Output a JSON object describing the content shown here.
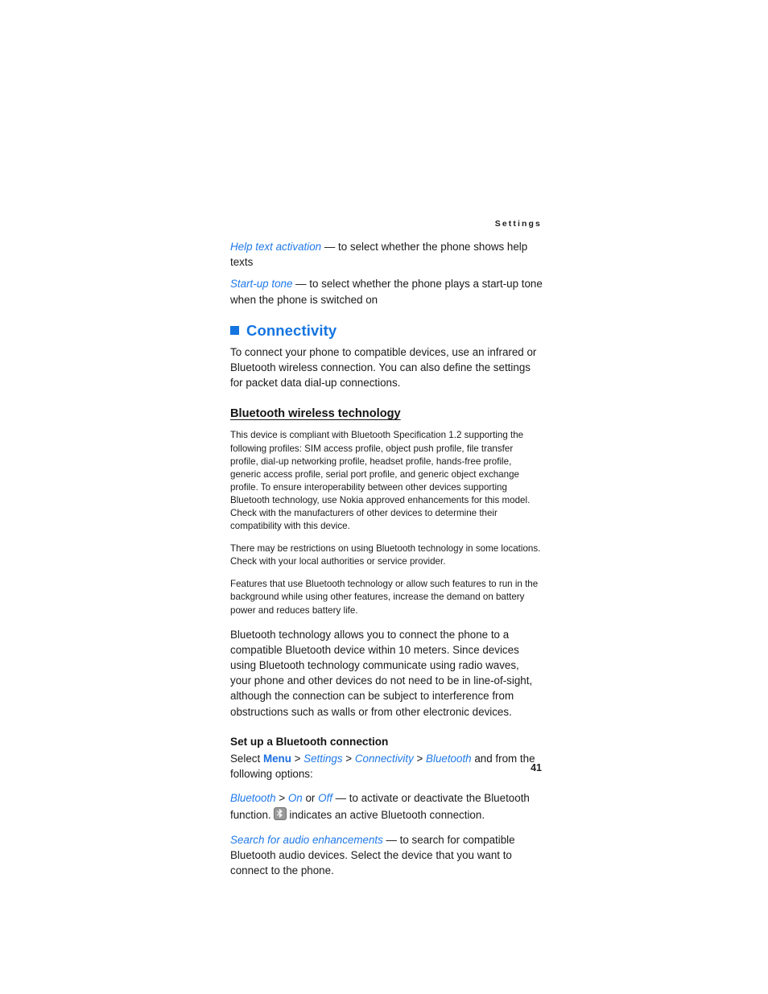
{
  "document": {
    "running_head": "Settings",
    "page_number": "41",
    "accent_color": "#1475e1",
    "link_color": "#2079e8",
    "text_color": "#1a1a1a",
    "background_color": "#ffffff"
  },
  "intro_options": {
    "help_text": {
      "term": "Help text activation",
      "dash": " — ",
      "description": "to select whether the phone shows help texts"
    },
    "startup_tone": {
      "term": "Start-up tone",
      "dash": " — ",
      "description": "to select whether the phone plays a start-up tone when the phone is switched on"
    }
  },
  "connectivity": {
    "heading": "Connectivity",
    "bullet_icon": "blue-square-bullet",
    "intro": "To connect your phone to compatible devices, use an infrared or Bluetooth wireless connection. You can also define the settings for packet data dial-up connections.",
    "bluetooth_section": {
      "heading": "Bluetooth wireless technology",
      "paragraphs": [
        "This device is compliant with Bluetooth Specification 1.2 supporting the following profiles: SIM access profile, object push profile, file transfer profile, dial-up networking profile, headset profile, hands-free profile, generic access profile, serial port profile, and generic object exchange profile. To ensure interoperability between other devices supporting Bluetooth technology, use Nokia approved enhancements for this model. Check with the manufacturers of other devices to determine their compatibility with this device.",
        "There may be restrictions on using Bluetooth technology in some locations. Check with your local authorities or service provider.",
        "Features that use Bluetooth technology or allow such features to run in the background while using other features, increase the demand on battery power and reduces battery life."
      ],
      "body_paragraph": "Bluetooth technology allows you to connect the phone to a compatible Bluetooth device within 10 meters. Since devices using Bluetooth technology communicate using radio waves, your phone and other devices do not need to be in line-of-sight, although the connection can be subject to interference from obstructions such as walls or from other electronic devices."
    },
    "setup_section": {
      "heading": "Set up a Bluetooth connection",
      "path_intro": "Select ",
      "path": {
        "menu": "Menu",
        "settings": "Settings",
        "connectivity": "Connectivity",
        "bluetooth": "Bluetooth",
        "separator": " > "
      },
      "path_outro": " and from the following options:",
      "options": [
        {
          "term": "Bluetooth",
          "separator": " > ",
          "value_on": "On",
          "conjunction": " or ",
          "value_off": "Off",
          "dash": " — ",
          "description": "to activate or deactivate the Bluetooth function.",
          "icon": "bluetooth-icon",
          "icon_description": "indicates an active Bluetooth connection."
        },
        {
          "term": "Search for audio enhancements",
          "dash": " — ",
          "description": "to search for compatible Bluetooth audio devices. Select the device that you want to connect to the phone."
        }
      ]
    }
  }
}
